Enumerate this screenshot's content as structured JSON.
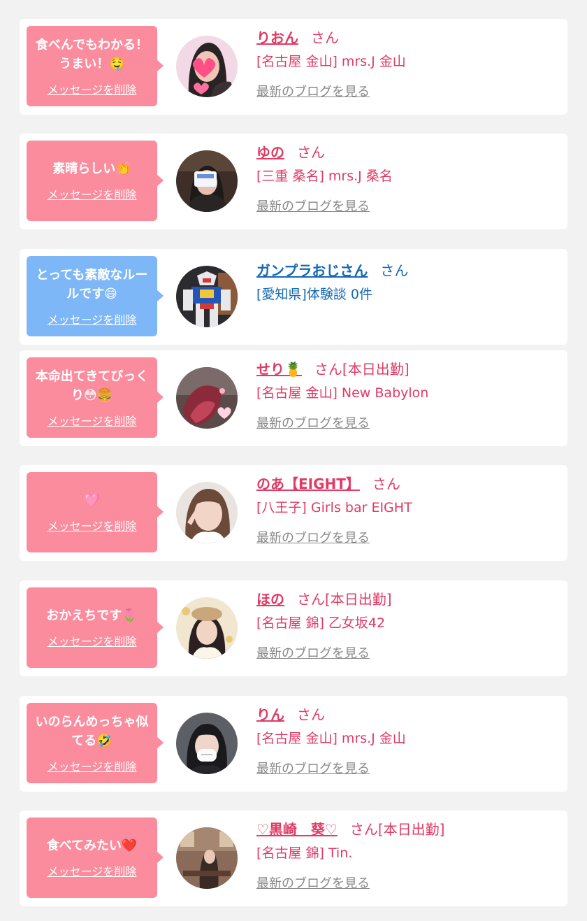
{
  "items": [
    {
      "message": "食べんでもわかる！うまい！🤤",
      "delete_label": "メッセージを削除",
      "avatar": "avatar-1",
      "name": "りおん",
      "suffix": "さん",
      "shop": "[名古屋 金山] mrs.J 金山",
      "blog_label": "最新のブログを見る"
    },
    {
      "message": "素晴らしい👏",
      "delete_label": "メッセージを削除",
      "avatar": "avatar-2",
      "name": "ゆの",
      "suffix": "さん",
      "shop": "[三重 桑名] mrs.J 桑名",
      "blog_label": "最新のブログを見る"
    },
    {
      "message": "とっても素敵なルールです😄",
      "delete_label": "メッセージを削除",
      "avatar": "avatar-3",
      "name": "ガンプラおじさん",
      "suffix": "さん",
      "shop": "[愛知県]体験談 0件",
      "blog_label": ""
    },
    {
      "message": "本命出てきてびっくり😳🍔",
      "delete_label": "メッセージを削除",
      "avatar": "avatar-4",
      "name": "せり🍍",
      "suffix": "さん[本日出勤]",
      "shop": "[名古屋 金山] New Babylon",
      "blog_label": "最新のブログを見る"
    },
    {
      "message": "🩷",
      "delete_label": "メッセージを削除",
      "avatar": "avatar-5",
      "name": "のあ【EIGHT】",
      "suffix": "さん",
      "shop": "[八王子] Girls bar EIGHT",
      "blog_label": "最新のブログを見る"
    },
    {
      "message": "おかえちです🌷",
      "delete_label": "メッセージを削除",
      "avatar": "avatar-6",
      "name": "ほの",
      "suffix": "さん[本日出勤]",
      "shop": "[名古屋 錦] 乙女坂42",
      "blog_label": "最新のブログを見る"
    },
    {
      "message": "いのらんめっちゃ似てる🤣",
      "delete_label": "メッセージを削除",
      "avatar": "avatar-7",
      "name": "りん",
      "suffix": "さん",
      "shop": "[名古屋 金山] mrs.J 金山",
      "blog_label": "最新のブログを見る"
    },
    {
      "message": "食べてみたい❤️",
      "delete_label": "メッセージを削除",
      "avatar": "avatar-8",
      "name": "♡黒崎　葵♡",
      "suffix": "さん[本日出勤]",
      "shop": "[名古屋 錦] Tin.",
      "blog_label": "最新のブログを見る"
    }
  ],
  "colors": {
    "pink_bubble": "#fb8c9d",
    "blue_bubble": "#7eb7f7",
    "pink_text": "#e13a64",
    "blue_text": "#1468b4",
    "link_gray": "#888888",
    "background": "#f2f2f2"
  }
}
